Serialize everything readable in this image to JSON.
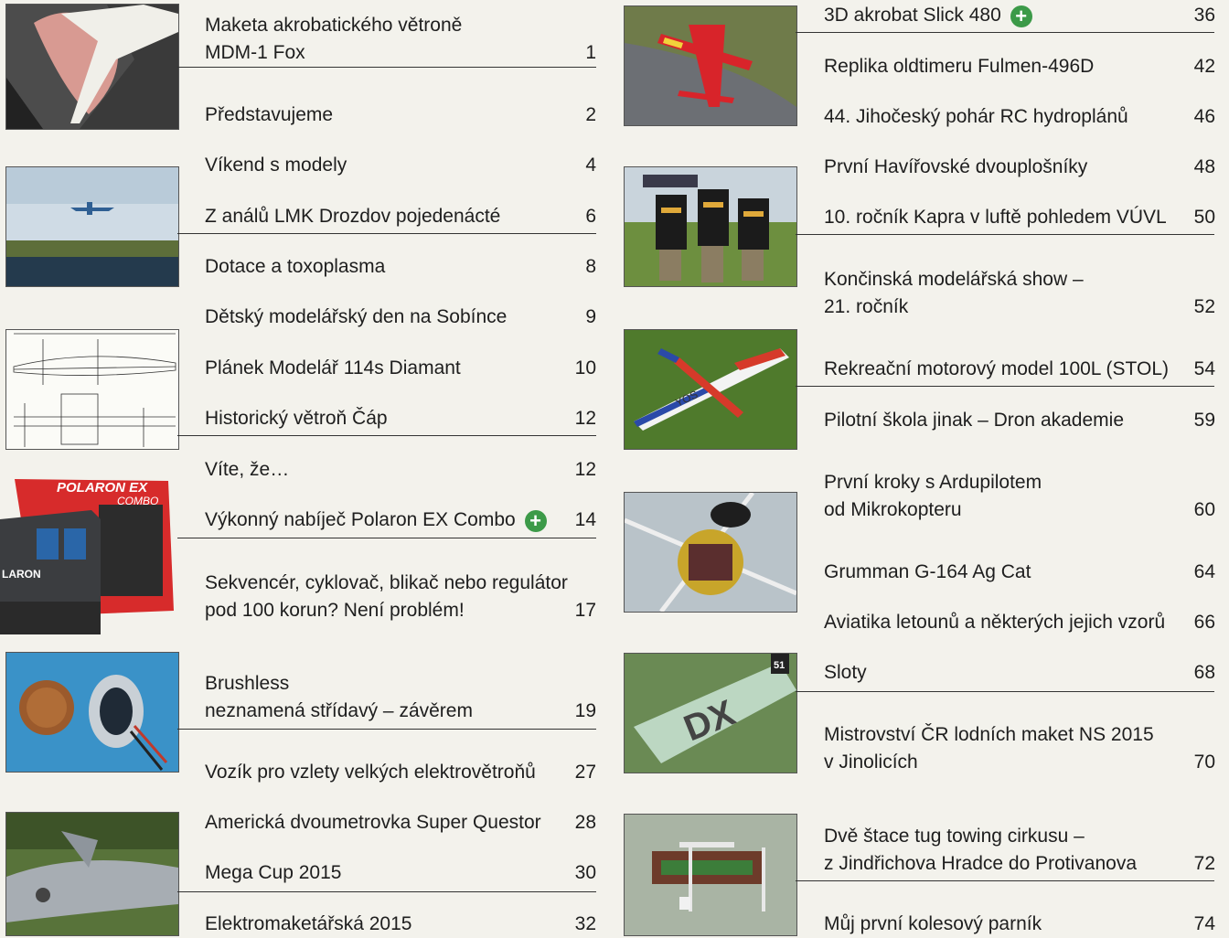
{
  "left_column": [
    {
      "lines": [
        "Maketa akrobatického větroně",
        "MDM-1 Fox"
      ],
      "page": "1"
    },
    {
      "lines": [
        "Představujeme"
      ],
      "page": "2"
    },
    {
      "lines": [
        "Víkend s modely"
      ],
      "page": "4"
    },
    {
      "lines": [
        "Z análů LMK Drozdov pojedenácté"
      ],
      "page": "6"
    },
    {
      "lines": [
        "Dotace a toxoplasma"
      ],
      "page": "8"
    },
    {
      "lines": [
        "Dětský modelářský den na Sobínce"
      ],
      "page": "9"
    },
    {
      "lines": [
        "Plánek Modelář 114s Diamant"
      ],
      "page": "10"
    },
    {
      "lines": [
        "Historický větroň Čáp"
      ],
      "page": "12"
    },
    {
      "lines": [
        "Víte, že…"
      ],
      "page": "12"
    },
    {
      "lines": [
        "Výkonný nabíječ Polaron EX Combo"
      ],
      "page": "14",
      "plus": true
    },
    {
      "lines": [
        "Sekvencér, cyklovač, blikač nebo regulátor",
        "pod 100 korun? Není problém!"
      ],
      "page": "17"
    },
    {
      "lines": [
        "Brushless",
        "neznamená střídavý – závěrem"
      ],
      "page": "19"
    },
    {
      "lines": [
        "Vozík pro vzlety velkých elektrovětroňů"
      ],
      "page": "27"
    },
    {
      "lines": [
        "Americká dvoumetrovka Super Questor"
      ],
      "page": "28"
    },
    {
      "lines": [
        "Mega Cup 2015"
      ],
      "page": "30"
    },
    {
      "lines": [
        "Elektromaketářská 2015"
      ],
      "page": "32"
    }
  ],
  "right_column": [
    {
      "lines": [
        "3D akrobat Slick 480"
      ],
      "page": "36",
      "plus": true
    },
    {
      "lines": [
        "Replika oldtimeru Fulmen-496D"
      ],
      "page": "42"
    },
    {
      "lines": [
        "44. Jihočeský pohár RC hydroplánů"
      ],
      "page": "46"
    },
    {
      "lines": [
        "První Havířovské dvouplošníky"
      ],
      "page": "48"
    },
    {
      "lines": [
        "10. ročník Kapra v luftě pohledem VÚVL"
      ],
      "page": "50"
    },
    {
      "lines": [
        "Končinská modelářská show –",
        "21. ročník"
      ],
      "page": "52"
    },
    {
      "lines": [
        "Rekreační motorový model 100L (STOL)"
      ],
      "page": "54"
    },
    {
      "lines": [
        "Pilotní škola jinak – Dron akademie"
      ],
      "page": "59"
    },
    {
      "lines": [
        "První kroky s Ardupilotem",
        "od Mikrokopteru"
      ],
      "page": "60"
    },
    {
      "lines": [
        "Grumman G-164 Ag Cat"
      ],
      "page": "64"
    },
    {
      "lines": [
        "Aviatika letounů a některých jejich vzorů"
      ],
      "page": "66"
    },
    {
      "lines": [
        "Sloty"
      ],
      "page": "68"
    },
    {
      "lines": [
        "Mistrovství ČR lodních maket NS 2015",
        "v Jinolicích"
      ],
      "page": "70"
    },
    {
      "lines": [
        "Dvě štace tug towing cirkusu –",
        "z Jindřichova Hradce do Protivanova"
      ],
      "page": "72"
    },
    {
      "lines": [
        "Můj první kolesový parník"
      ],
      "page": "74"
    }
  ],
  "photo_text": {
    "charger_box_brand": "POLARON EX",
    "charger_box_sub": "COMBO",
    "charger_side": "LARON",
    "wing_reg": "DX",
    "wing_num": "51",
    "plane_side": "YOS"
  },
  "colors": {
    "page_bg": "#f3f2ec",
    "plus_icon": "#3c9a48",
    "rule": "#333333"
  }
}
